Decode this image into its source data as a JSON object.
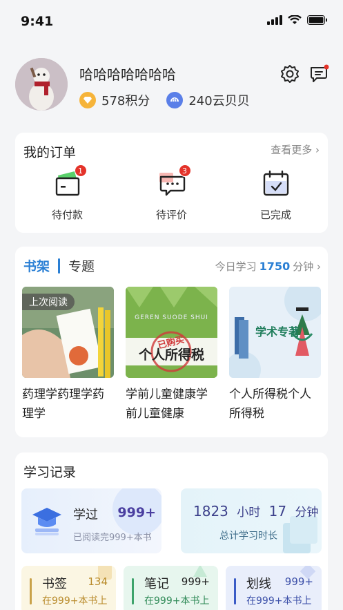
{
  "status_bar": {
    "time": "9:41"
  },
  "profile": {
    "username": "哈哈哈哈哈哈哈",
    "points": "578积分",
    "cloud_coins": "240云贝贝"
  },
  "orders": {
    "title": "我的订单",
    "more": "查看更多",
    "items": [
      {
        "label": "待付款",
        "count": "1"
      },
      {
        "label": "待评价",
        "count": "3"
      },
      {
        "label": "已完成"
      }
    ]
  },
  "shelf": {
    "tab_active": "书架",
    "tab_other": "专题",
    "today_prefix": "今日学习",
    "today_value": "1750",
    "today_unit": "分钟",
    "last_read_tag": "上次阅读",
    "books": [
      {
        "title": "药理学药理学药理学"
      },
      {
        "title": "学前儿童健康学前儿童健康",
        "cover_text": "个人所得税",
        "cover_stamp": "已购买",
        "cover_sub": "GEREN SUODE SHUI"
      },
      {
        "title": "个人所得税个人所得税",
        "cover_text": "学术专著"
      }
    ]
  },
  "records": {
    "title": "学习记录",
    "learned_label": "学过",
    "learned_value": "999+",
    "learned_sub": "已阅读完999+本书",
    "total_hours": "1823",
    "hours_unit": "小时",
    "total_minutes": "17",
    "minutes_unit": "分钟",
    "total_sub": "总计学习时长",
    "mini": [
      {
        "title": "书签",
        "value": "134",
        "sub": "在999+本书上",
        "color": "#c9a24a"
      },
      {
        "title": "笔记",
        "value": "999+",
        "sub": "在999+本书上",
        "color": "#3da36b"
      },
      {
        "title": "划线",
        "value": "999+",
        "sub": "在999+本书上",
        "color": "#3b5bc6"
      }
    ]
  }
}
